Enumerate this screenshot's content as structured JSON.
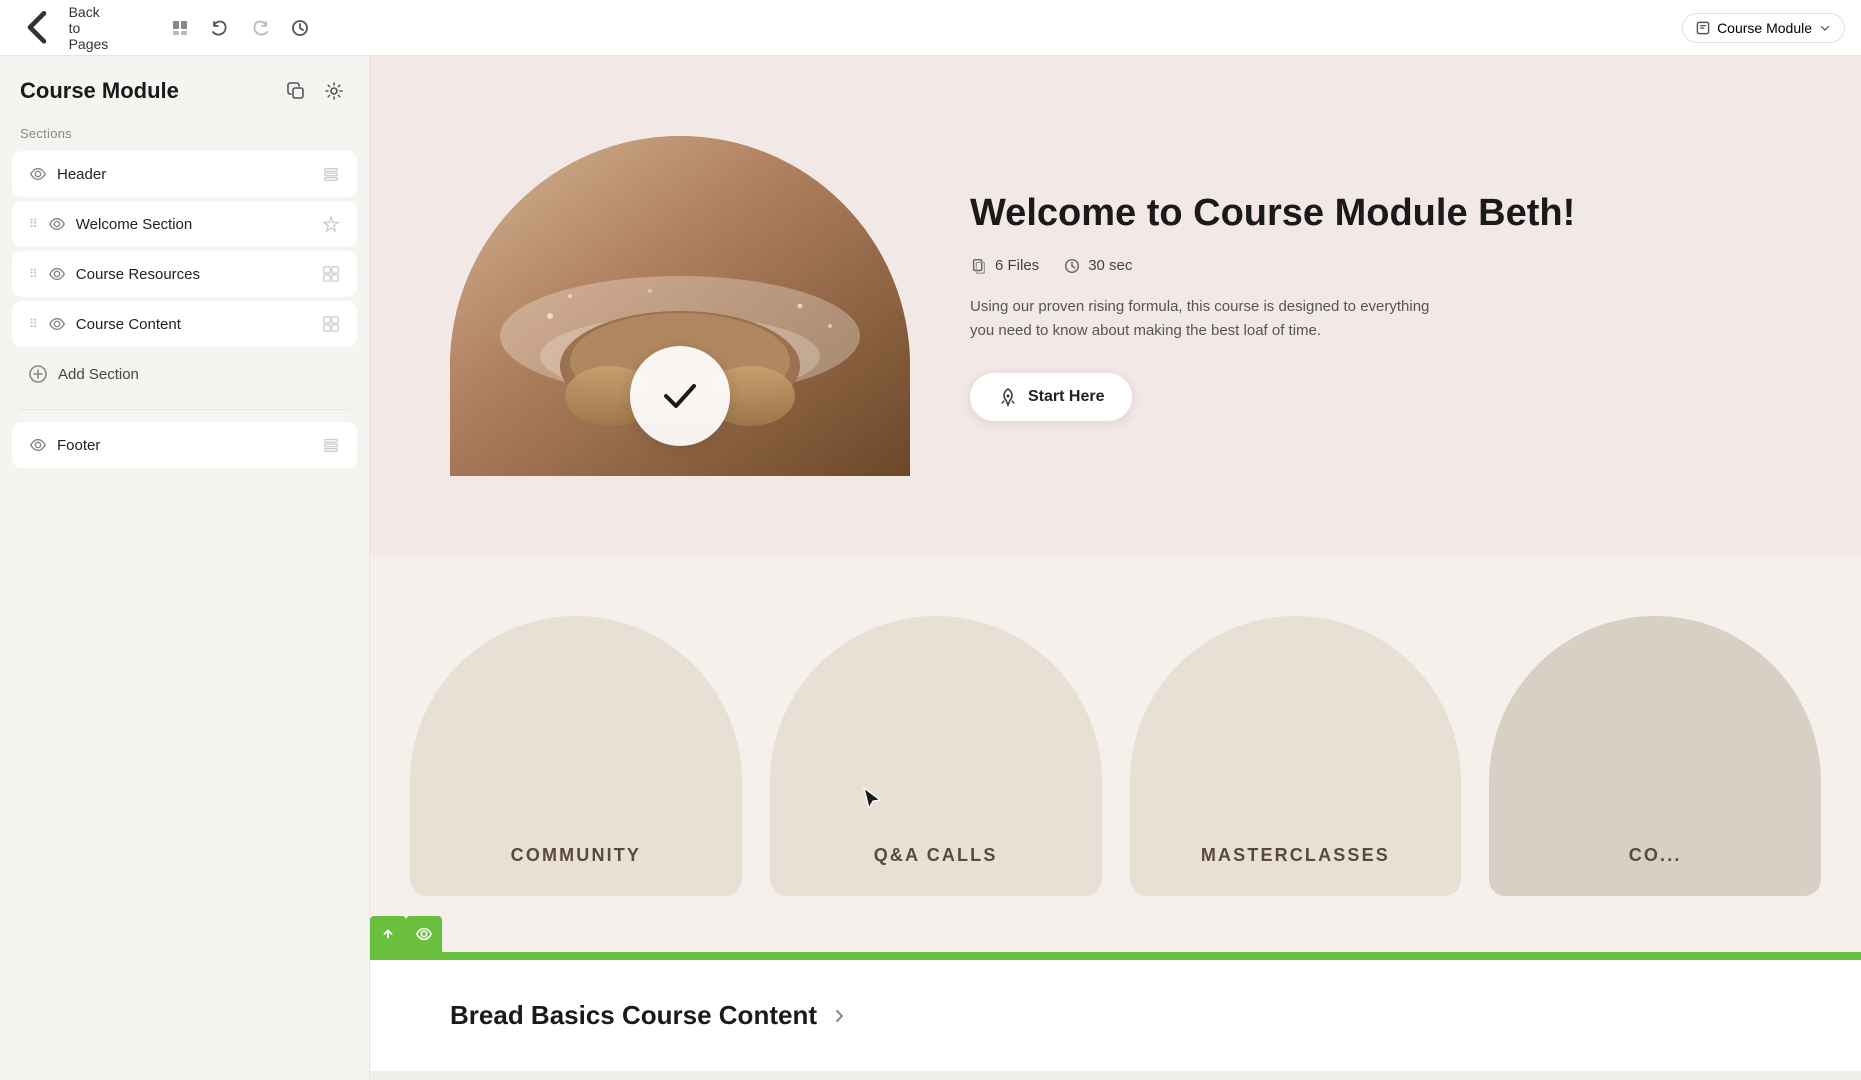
{
  "topbar": {
    "back_label": "Back to Pages",
    "undo_label": "Undo",
    "redo_label": "Redo",
    "history_label": "History",
    "pages_icon": "pages",
    "module_name": "Course Module"
  },
  "sidebar": {
    "title": "Course Module",
    "sections_label": "Sections",
    "items": [
      {
        "id": "header",
        "name": "Header",
        "has_drag": false,
        "action_icon": "layout"
      },
      {
        "id": "welcome",
        "name": "Welcome Section",
        "has_drag": true,
        "action_icon": "star"
      },
      {
        "id": "resources",
        "name": "Course Resources",
        "has_drag": true,
        "action_icon": "grid"
      },
      {
        "id": "content",
        "name": "Course Content",
        "has_drag": true,
        "action_icon": "grid"
      }
    ],
    "add_section_label": "Add Section",
    "footer_item": {
      "name": "Footer",
      "action_icon": "layout"
    }
  },
  "hero": {
    "title": "Welcome to Course Module Beth!",
    "files_count": "6 Files",
    "duration": "30 sec",
    "description": "Using our proven rising formula, this course is designed to everything you need to know about making the best loaf of time.",
    "cta_label": "Start Here"
  },
  "cards": [
    {
      "label": "COMMUNITY"
    },
    {
      "label": "Q&A CALLS"
    },
    {
      "label": "MASTERCLASSES"
    },
    {
      "label": "CO..."
    }
  ],
  "course_content": {
    "title": "Bread Basics Course Content"
  },
  "floating_bar": {
    "up_label": "↑",
    "eye_label": "👁"
  }
}
